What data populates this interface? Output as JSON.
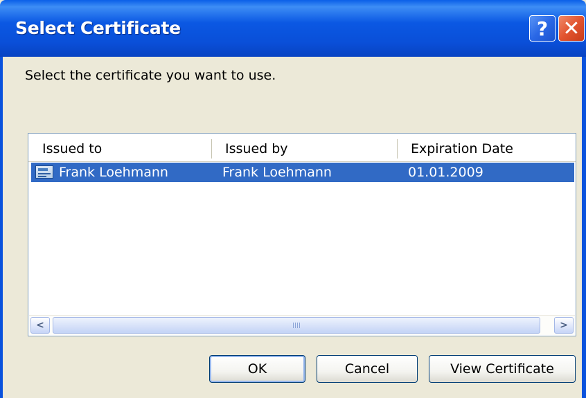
{
  "window": {
    "title": "Select Certificate",
    "help_label": "?",
    "close_label": "✕"
  },
  "instruction": "Select the certificate you want to use.",
  "list": {
    "columns": [
      "Issued to",
      "Issued by",
      "Expiration Date"
    ],
    "rows": [
      {
        "issued_to": "Frank Loehmann",
        "issued_by": "Frank Loehmann",
        "expiration_date": "01.01.2009",
        "selected": true,
        "icon": "certificate-icon"
      }
    ],
    "scroll_left": "<",
    "scroll_right": ">"
  },
  "buttons": {
    "ok": "OK",
    "cancel": "Cancel",
    "view_certificate": "View Certificate"
  },
  "colors": {
    "titlebar": "#0a52dd",
    "selection": "#316ac5",
    "dialog_bg": "#ece9d8"
  }
}
